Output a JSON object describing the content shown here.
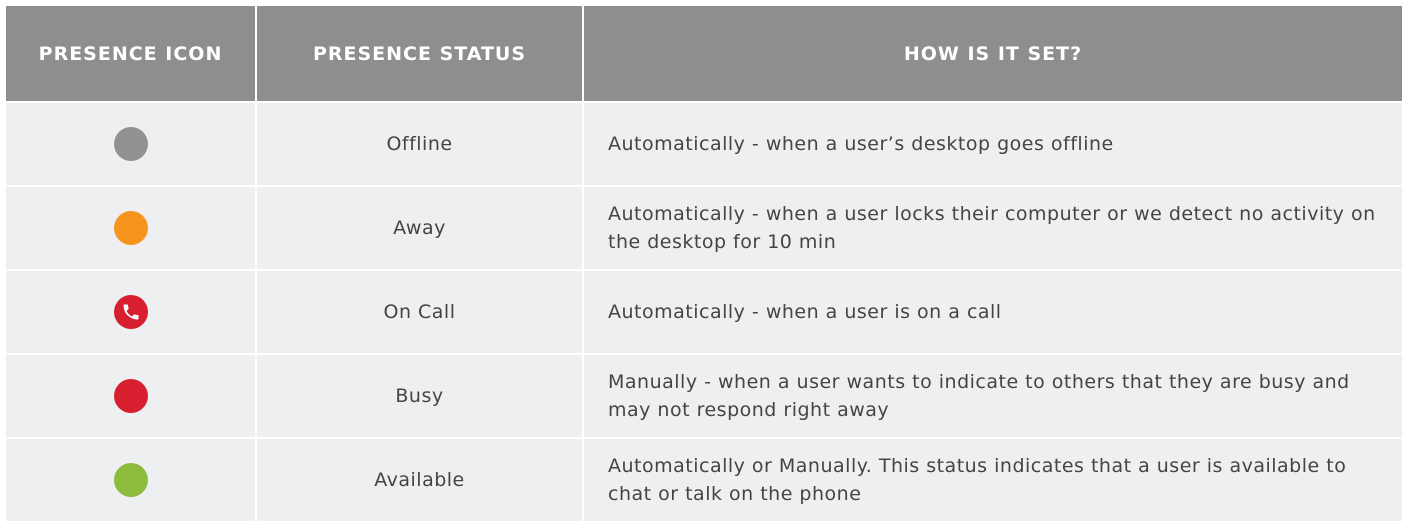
{
  "table": {
    "headers": {
      "icon": "PRESENCE ICON",
      "status": "PRESENCE STATUS",
      "how": "HOW IS IT SET?"
    },
    "rows": [
      {
        "icon": "gray-dot-icon",
        "color": "#929292",
        "status": "Offline",
        "how": "Automatically - when a user’s desktop goes offline"
      },
      {
        "icon": "orange-dot-icon",
        "color": "#f7941d",
        "status": "Away",
        "how": "Automatically - when a user locks their computer or we detect no activity on the desktop for 10 min"
      },
      {
        "icon": "phone-icon",
        "color": "#d71f2f",
        "status": "On Call",
        "how": "Automatically - when a user is on a call"
      },
      {
        "icon": "red-dot-icon",
        "color": "#d71f2f",
        "status": "Busy",
        "how": "Manually - when a user wants to indicate to others that they are busy and may not respond right away"
      },
      {
        "icon": "green-dot-icon",
        "color": "#8dbb3c",
        "status": "Available",
        "how": "Automatically or Manually.  This status indicates that a user is available to chat or talk on the phone"
      }
    ]
  }
}
